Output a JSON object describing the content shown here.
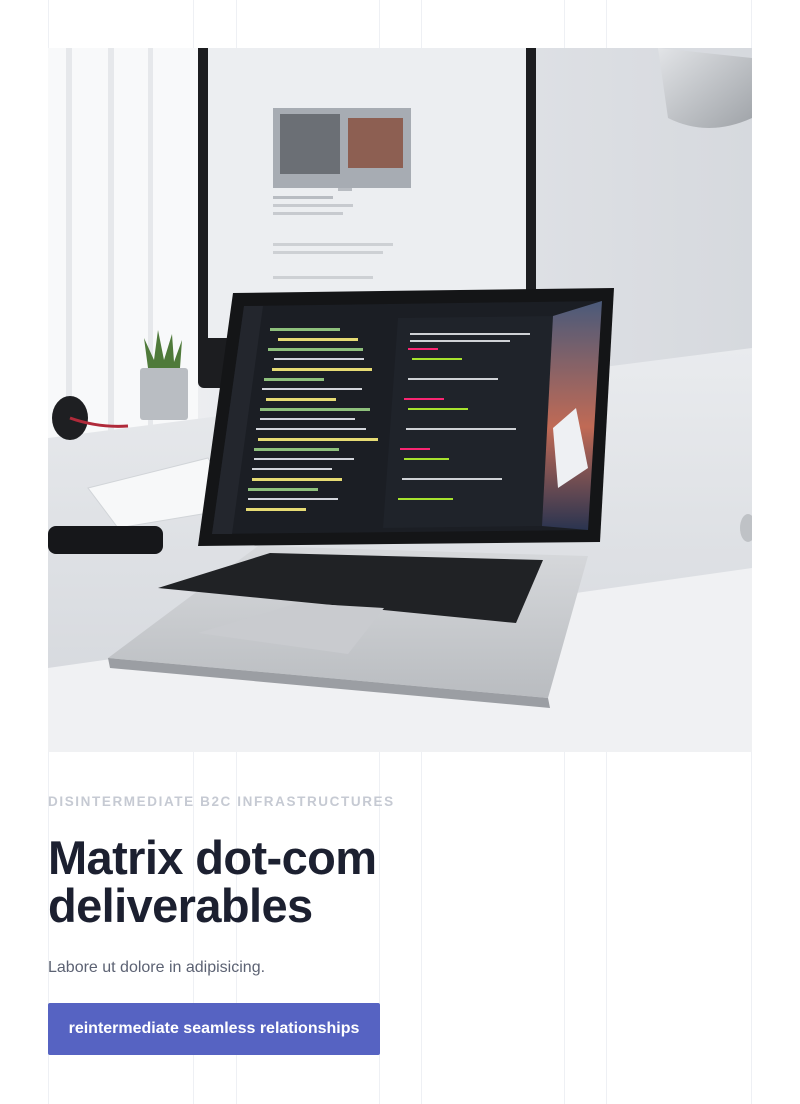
{
  "hero": {
    "image_alt": "Laptop with code editor on a white desk next to a monitor"
  },
  "eyebrow": "DISINTERMEDIATE B2C INFRASTRUCTURES",
  "title": "Matrix dot-com deliverables",
  "description": "Labore ut dolore in adipisicing.",
  "cta_label": "reintermediate seamless relationships",
  "colors": {
    "accent": "#5663c2",
    "heading": "#1c2030",
    "eyebrow": "#c6cad3",
    "body_text": "#5c6273"
  }
}
